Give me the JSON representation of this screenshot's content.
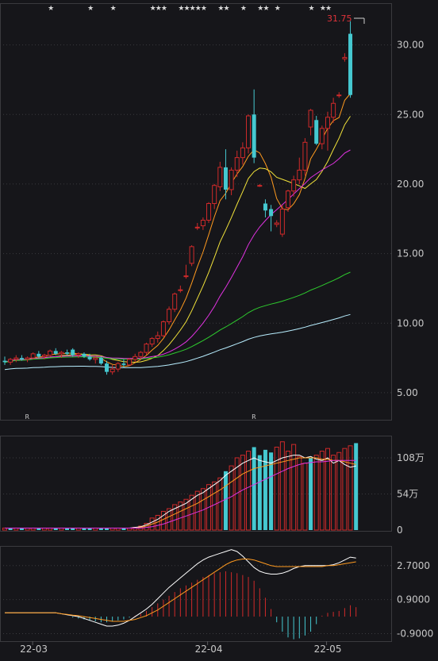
{
  "chart_data": [
    {
      "type": "candlestick",
      "panel": "price",
      "ylim": [
        3,
        33
      ],
      "yticks": [
        "30.00",
        "25.00",
        "20.00",
        "15.00",
        "10.00",
        "5.00"
      ],
      "ytick_values": [
        30,
        25,
        20,
        15,
        10,
        5
      ],
      "max_label": "31.75",
      "max_value": 31.75,
      "r_markers": [
        "R",
        "R"
      ],
      "star_markers": [
        "★",
        "★",
        "★",
        "★",
        "★",
        "★",
        "★",
        "★",
        "★",
        "★",
        "★",
        "★",
        "★",
        "★",
        "★",
        "★",
        "★",
        "★",
        "★",
        "★"
      ],
      "colors": {
        "up": "#d02a2a",
        "down": "#45c8d0",
        "ma5": "#ff9a1f",
        "ma10": "#f2e33a",
        "ma20": "#e032e0",
        "ma60": "#2ecc2e",
        "ma120": "#b8eeff"
      },
      "candles": [
        {
          "o": 7.3,
          "h": 7.6,
          "l": 7.0,
          "c": 7.2
        },
        {
          "o": 7.2,
          "h": 7.5,
          "l": 7.0,
          "c": 7.4
        },
        {
          "o": 7.4,
          "h": 7.7,
          "l": 7.2,
          "c": 7.5
        },
        {
          "o": 7.5,
          "h": 7.7,
          "l": 7.3,
          "c": 7.4
        },
        {
          "o": 7.4,
          "h": 7.6,
          "l": 7.2,
          "c": 7.5
        },
        {
          "o": 7.5,
          "h": 7.9,
          "l": 7.4,
          "c": 7.8
        },
        {
          "o": 7.8,
          "h": 8.0,
          "l": 7.5,
          "c": 7.6
        },
        {
          "o": 7.6,
          "h": 7.8,
          "l": 7.4,
          "c": 7.7
        },
        {
          "o": 7.7,
          "h": 8.1,
          "l": 7.6,
          "c": 8.0
        },
        {
          "o": 8.0,
          "h": 8.2,
          "l": 7.7,
          "c": 7.8
        },
        {
          "o": 7.8,
          "h": 8.0,
          "l": 7.5,
          "c": 7.9
        },
        {
          "o": 7.9,
          "h": 8.1,
          "l": 7.7,
          "c": 7.8
        },
        {
          "o": 8.1,
          "h": 8.2,
          "l": 7.6,
          "c": 7.7
        },
        {
          "o": 7.7,
          "h": 7.9,
          "l": 7.5,
          "c": 7.8
        },
        {
          "o": 7.8,
          "h": 7.9,
          "l": 7.5,
          "c": 7.6
        },
        {
          "o": 7.6,
          "h": 7.8,
          "l": 7.3,
          "c": 7.4
        },
        {
          "o": 7.4,
          "h": 7.6,
          "l": 7.1,
          "c": 7.5
        },
        {
          "o": 7.5,
          "h": 7.6,
          "l": 7.0,
          "c": 7.1
        },
        {
          "o": 7.1,
          "h": 7.3,
          "l": 6.3,
          "c": 6.5
        },
        {
          "o": 6.5,
          "h": 7.0,
          "l": 6.3,
          "c": 6.7
        },
        {
          "o": 6.7,
          "h": 7.2,
          "l": 6.5,
          "c": 7.1
        },
        {
          "o": 7.1,
          "h": 7.4,
          "l": 6.8,
          "c": 7.0
        },
        {
          "o": 7.0,
          "h": 7.5,
          "l": 6.9,
          "c": 7.4
        },
        {
          "o": 7.4,
          "h": 7.8,
          "l": 7.2,
          "c": 7.6
        },
        {
          "o": 7.6,
          "h": 8.0,
          "l": 7.4,
          "c": 7.9
        },
        {
          "o": 7.9,
          "h": 8.6,
          "l": 7.7,
          "c": 8.5
        },
        {
          "o": 8.5,
          "h": 9.0,
          "l": 8.3,
          "c": 8.9
        },
        {
          "o": 8.9,
          "h": 9.4,
          "l": 8.6,
          "c": 9.1
        },
        {
          "o": 9.1,
          "h": 10.2,
          "l": 9.0,
          "c": 10.1
        },
        {
          "o": 10.1,
          "h": 11.2,
          "l": 9.9,
          "c": 11.0
        },
        {
          "o": 11.0,
          "h": 12.2,
          "l": 10.8,
          "c": 12.1
        },
        {
          "o": 12.4,
          "h": 12.7,
          "l": 12.2,
          "c": 12.4
        },
        {
          "o": 13.4,
          "h": 14.2,
          "l": 13.2,
          "c": 13.4
        },
        {
          "o": 14.3,
          "h": 15.6,
          "l": 14.1,
          "c": 15.5
        },
        {
          "o": 16.9,
          "h": 17.2,
          "l": 16.7,
          "c": 16.9
        },
        {
          "o": 17.0,
          "h": 17.6,
          "l": 16.7,
          "c": 17.4
        },
        {
          "o": 17.4,
          "h": 18.7,
          "l": 17.2,
          "c": 18.6
        },
        {
          "o": 18.6,
          "h": 20.0,
          "l": 18.2,
          "c": 19.9
        },
        {
          "o": 19.8,
          "h": 21.6,
          "l": 19.5,
          "c": 21.2
        },
        {
          "o": 21.2,
          "h": 22.5,
          "l": 18.9,
          "c": 19.6
        },
        {
          "o": 19.6,
          "h": 21.2,
          "l": 19.2,
          "c": 21.0
        },
        {
          "o": 21.0,
          "h": 22.4,
          "l": 20.5,
          "c": 21.9
        },
        {
          "o": 21.9,
          "h": 23.0,
          "l": 21.4,
          "c": 22.6
        },
        {
          "o": 22.6,
          "h": 25.0,
          "l": 22.2,
          "c": 24.9
        },
        {
          "o": 25.0,
          "h": 26.8,
          "l": 21.5,
          "c": 21.9
        },
        {
          "o": 19.9,
          "h": 20.0,
          "l": 19.8,
          "c": 19.9
        },
        {
          "o": 18.6,
          "h": 18.9,
          "l": 17.6,
          "c": 18.1
        },
        {
          "o": 18.2,
          "h": 18.5,
          "l": 16.6,
          "c": 17.7
        },
        {
          "o": 17.1,
          "h": 17.4,
          "l": 16.9,
          "c": 17.2
        },
        {
          "o": 16.4,
          "h": 18.5,
          "l": 16.2,
          "c": 18.2
        },
        {
          "o": 18.3,
          "h": 19.6,
          "l": 18.0,
          "c": 19.5
        },
        {
          "o": 19.5,
          "h": 20.6,
          "l": 19.1,
          "c": 20.3
        },
        {
          "o": 20.3,
          "h": 21.9,
          "l": 20.0,
          "c": 21.0
        },
        {
          "o": 21.0,
          "h": 23.3,
          "l": 20.6,
          "c": 23.0
        },
        {
          "o": 24.1,
          "h": 25.4,
          "l": 23.5,
          "c": 25.3
        },
        {
          "o": 24.6,
          "h": 24.9,
          "l": 22.8,
          "c": 22.9
        },
        {
          "o": 22.9,
          "h": 24.2,
          "l": 22.5,
          "c": 24.0
        },
        {
          "o": 24.0,
          "h": 25.2,
          "l": 22.4,
          "c": 24.8
        },
        {
          "o": 24.8,
          "h": 26.2,
          "l": 24.4,
          "c": 25.8
        },
        {
          "o": 26.4,
          "h": 26.6,
          "l": 26.2,
          "c": 26.4
        },
        {
          "o": 29.0,
          "h": 29.4,
          "l": 28.8,
          "c": 29.1
        },
        {
          "o": 30.8,
          "h": 31.7,
          "l": 26.2,
          "c": 26.4
        }
      ]
    },
    {
      "type": "bar",
      "panel": "volume",
      "ylim": [
        0,
        140
      ],
      "yticks": [
        "108万",
        "54万",
        "0"
      ],
      "ytick_values": [
        108,
        54,
        0
      ],
      "values": [
        3,
        3,
        3,
        3,
        3,
        3,
        3,
        3,
        3,
        3,
        3,
        3,
        3,
        3,
        3,
        3,
        3,
        3,
        3,
        3,
        3,
        3,
        3,
        4,
        6,
        10,
        18,
        22,
        28,
        32,
        38,
        42,
        46,
        52,
        58,
        62,
        68,
        72,
        78,
        88,
        96,
        108,
        112,
        118,
        124,
        112,
        120,
        116,
        124,
        132,
        118,
        128,
        110,
        100,
        108,
        112,
        118,
        122,
        112,
        116,
        122,
        126,
        130
      ],
      "directions": [
        "u",
        "d",
        "u",
        "d",
        "u",
        "u",
        "d",
        "u",
        "u",
        "d",
        "u",
        "d",
        "d",
        "u",
        "d",
        "d",
        "u",
        "d",
        "d",
        "u",
        "u",
        "d",
        "u",
        "u",
        "u",
        "u",
        "u",
        "u",
        "u",
        "u",
        "u",
        "u",
        "u",
        "u",
        "u",
        "u",
        "u",
        "u",
        "u",
        "d",
        "u",
        "u",
        "u",
        "u",
        "d",
        "d",
        "d",
        "d",
        "u",
        "u",
        "u",
        "u",
        "u",
        "u",
        "d",
        "u",
        "u",
        "u",
        "u",
        "u",
        "u",
        "u",
        "d"
      ],
      "ma_lines": [
        {
          "color": "#ffffff",
          "values": [
            3,
            3,
            3,
            3,
            3,
            3,
            3,
            3,
            3,
            3,
            3,
            3,
            3,
            3,
            3,
            3,
            3,
            3,
            3,
            3,
            3,
            3,
            3,
            4,
            5,
            8,
            12,
            16,
            22,
            28,
            32,
            36,
            40,
            46,
            52,
            56,
            62,
            68,
            74,
            82,
            88,
            94,
            100,
            104,
            108,
            104,
            102,
            100,
            104,
            108,
            110,
            112,
            112,
            108,
            110,
            106,
            104,
            108,
            100,
            104,
            98,
            94,
            96
          ]
        },
        {
          "color": "#ff9a1f",
          "values": [
            3,
            3,
            3,
            3,
            3,
            3,
            3,
            3,
            3,
            3,
            3,
            3,
            3,
            3,
            3,
            3,
            3,
            3,
            3,
            3,
            3,
            3,
            3,
            3,
            4,
            6,
            9,
            12,
            16,
            20,
            24,
            28,
            32,
            36,
            40,
            45,
            50,
            55,
            60,
            66,
            72,
            78,
            84,
            88,
            92,
            94,
            96,
            98,
            100,
            102,
            104,
            106,
            108,
            108,
            108,
            108,
            106,
            106,
            104,
            104,
            102,
            100,
            98
          ]
        },
        {
          "color": "#e032e0",
          "values": [
            3,
            3,
            3,
            3,
            3,
            3,
            3,
            3,
            3,
            3,
            3,
            3,
            3,
            3,
            3,
            3,
            3,
            3,
            3,
            3,
            3,
            3,
            3,
            3,
            3,
            4,
            5,
            7,
            9,
            12,
            15,
            18,
            21,
            24,
            27,
            30,
            34,
            38,
            42,
            46,
            50,
            55,
            60,
            64,
            68,
            72,
            76,
            80,
            84,
            88,
            92,
            95,
            98,
            100,
            101,
            102,
            102,
            103,
            104,
            104,
            104,
            104,
            104
          ]
        }
      ]
    },
    {
      "type": "macd",
      "panel": "macd",
      "ylim": [
        -1.3,
        3.7
      ],
      "yticks": [
        "2.7000",
        "0.9000",
        "-0.9000"
      ],
      "ytick_values": [
        2.7,
        0.9,
        -0.9
      ],
      "histogram": [
        0,
        0,
        0,
        0,
        0,
        0,
        0,
        0,
        0,
        0,
        0,
        0,
        -0.05,
        -0.1,
        -0.15,
        -0.2,
        -0.25,
        -0.3,
        -0.3,
        -0.25,
        -0.2,
        -0.15,
        -0.05,
        0.05,
        0.15,
        0.3,
        0.5,
        0.7,
        0.9,
        1.1,
        1.3,
        1.5,
        1.65,
        1.8,
        1.95,
        2.1,
        2.2,
        2.3,
        2.35,
        2.4,
        2.35,
        2.3,
        2.2,
        2.1,
        1.9,
        1.5,
        1.0,
        0.4,
        -0.3,
        -0.8,
        -1.1,
        -1.2,
        -1.15,
        -1.0,
        -0.8,
        -0.4,
        0.05,
        0.2,
        0.25,
        0.3,
        0.45,
        0.6,
        0.5
      ],
      "dif": [
        0.2,
        0.2,
        0.2,
        0.2,
        0.2,
        0.2,
        0.2,
        0.2,
        0.2,
        0.2,
        0.15,
        0.1,
        0.05,
        0,
        -0.1,
        -0.2,
        -0.3,
        -0.4,
        -0.5,
        -0.5,
        -0.45,
        -0.35,
        -0.2,
        0,
        0.2,
        0.4,
        0.65,
        0.95,
        1.25,
        1.55,
        1.8,
        2.05,
        2.3,
        2.55,
        2.8,
        3.0,
        3.15,
        3.25,
        3.35,
        3.45,
        3.55,
        3.45,
        3.2,
        2.9,
        2.6,
        2.4,
        2.3,
        2.25,
        2.25,
        2.3,
        2.4,
        2.55,
        2.65,
        2.7,
        2.7,
        2.7,
        2.7,
        2.7,
        2.75,
        2.85,
        3.0,
        3.15,
        3.1
      ],
      "dea": [
        0.2,
        0.2,
        0.2,
        0.2,
        0.2,
        0.2,
        0.2,
        0.2,
        0.2,
        0.2,
        0.15,
        0.12,
        0.08,
        0.05,
        0,
        -0.05,
        -0.1,
        -0.15,
        -0.2,
        -0.25,
        -0.25,
        -0.25,
        -0.2,
        -0.15,
        -0.05,
        0.05,
        0.2,
        0.35,
        0.55,
        0.75,
        0.95,
        1.15,
        1.35,
        1.55,
        1.75,
        1.95,
        2.15,
        2.35,
        2.55,
        2.75,
        2.9,
        3.0,
        3.05,
        3.05,
        3.0,
        2.9,
        2.8,
        2.7,
        2.65,
        2.65,
        2.65,
        2.65,
        2.65,
        2.65,
        2.65,
        2.65,
        2.65,
        2.7,
        2.7,
        2.75,
        2.8,
        2.85,
        2.9
      ]
    }
  ],
  "x_axis": {
    "labels": [
      "22-03",
      "22-04",
      "22-05"
    ],
    "label_positions": [
      1,
      26,
      47
    ]
  }
}
